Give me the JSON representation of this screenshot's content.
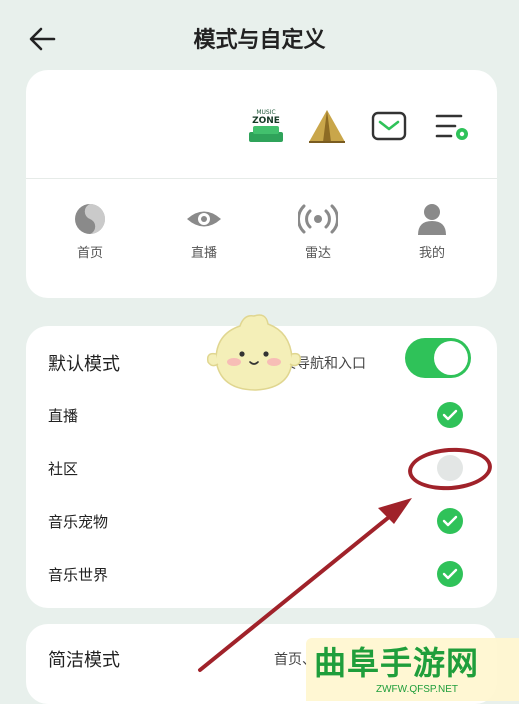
{
  "header": {
    "title": "模式与自定义"
  },
  "nav_preview": {
    "entry_icons": [
      "music-zone-icon",
      "tent-icon",
      "message-icon",
      "settings-list-icon"
    ],
    "music_zone_text": "ZONE",
    "music_zone_small": "MUSIC",
    "tabs": [
      {
        "label": "首页",
        "icon": "home-icon"
      },
      {
        "label": "直播",
        "icon": "eye-icon"
      },
      {
        "label": "雷达",
        "icon": "radar-icon"
      },
      {
        "label": "我的",
        "icon": "user-icon"
      }
    ]
  },
  "default_mode": {
    "label": "默认模式",
    "desc": "自定义导航和入口",
    "enabled": true,
    "options": [
      {
        "label": "直播",
        "checked": true
      },
      {
        "label": "社区",
        "checked": false
      },
      {
        "label": "音乐宠物",
        "checked": true
      },
      {
        "label": "音乐世界",
        "checked": true
      }
    ]
  },
  "simple_mode": {
    "label": "简洁模式",
    "desc": "首页、"
  },
  "watermark": {
    "title": "曲阜手游网",
    "url": "ZWFW.QFSP.NET"
  },
  "colors": {
    "accent": "#2fc259",
    "annotation": "#a0222a",
    "background": "#e8f0ec"
  }
}
